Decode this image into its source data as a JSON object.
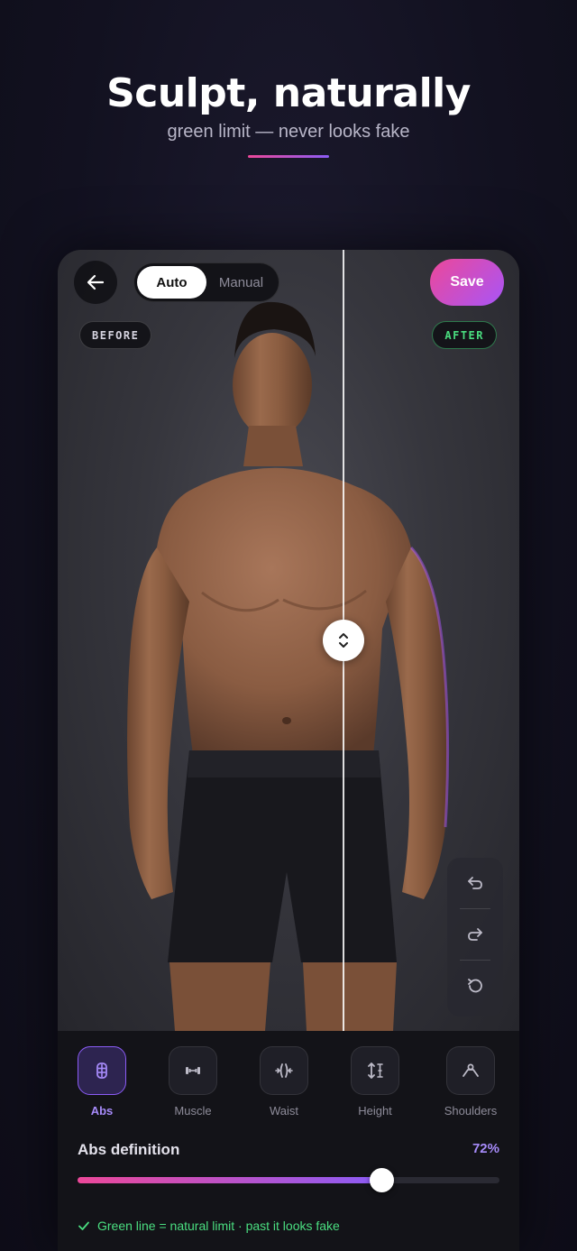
{
  "hero": {
    "title": "Sculpt, naturally",
    "subtitle": "green limit — never looks fake"
  },
  "editor": {
    "back_icon": "arrow-left-icon",
    "mode": {
      "options": [
        "Auto",
        "Manual"
      ],
      "selected": "Auto"
    },
    "save_label": "Save",
    "before_label": "BEFORE",
    "after_label": "AFTER",
    "compare_handle_icon": "chevron-up-down-icon",
    "history": [
      "undo-icon",
      "redo-icon",
      "reset-icon"
    ]
  },
  "tools": {
    "selected": "Abs",
    "items": [
      {
        "label": "Abs",
        "icon": "abs-icon"
      },
      {
        "label": "Muscle",
        "icon": "dumbbell-icon"
      },
      {
        "label": "Waist",
        "icon": "waist-icon"
      },
      {
        "label": "Height",
        "icon": "height-icon"
      },
      {
        "label": "Shoulders",
        "icon": "shoulders-icon"
      }
    ]
  },
  "slider": {
    "title": "Abs definition",
    "value_label": "72%",
    "value": 0.72
  },
  "hint": {
    "icon": "check-icon",
    "text": "Green line = natural limit · past it looks fake"
  },
  "colors": {
    "accent_pink": "#ec4899",
    "accent_purple": "#8b5cf6",
    "limit_green": "#4ade80"
  }
}
